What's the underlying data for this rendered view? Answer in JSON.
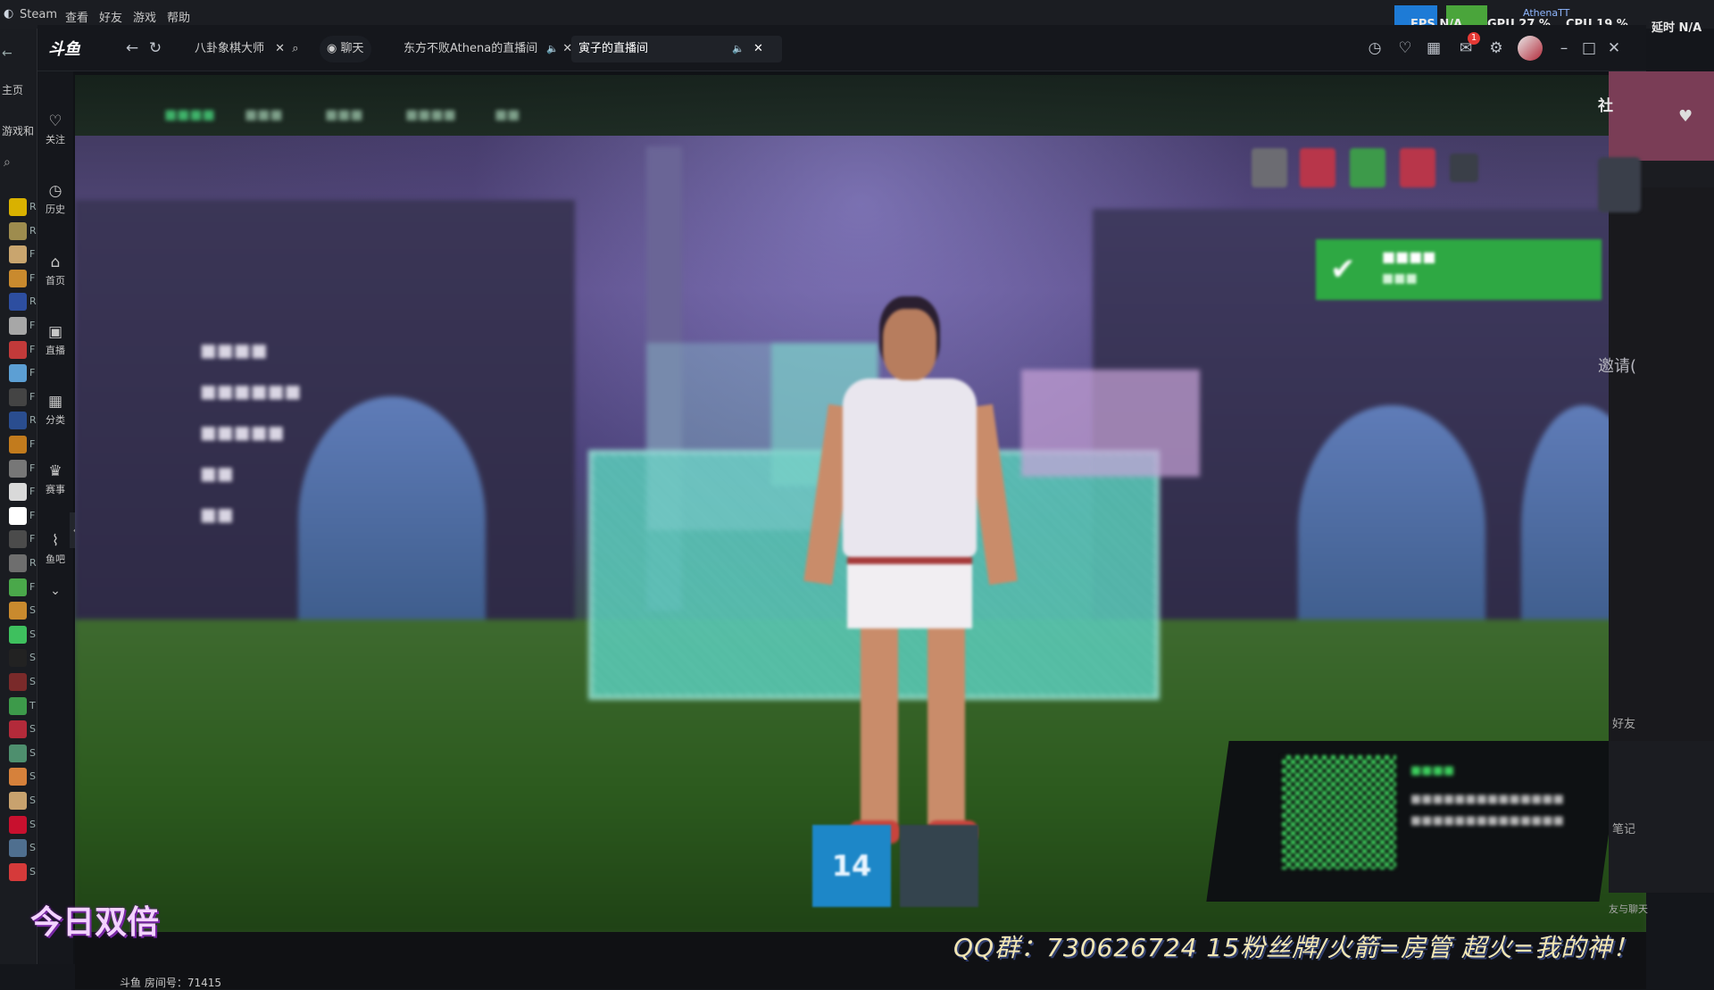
{
  "steam": {
    "app_label": "Steam",
    "menus": [
      "查看",
      "好友",
      "游戏",
      "帮助"
    ],
    "nav": [
      "主页",
      "游戏和"
    ],
    "game_letters": [
      "R",
      "R",
      "F",
      "F",
      "R",
      "F",
      "F",
      "F",
      "F",
      "R",
      "F",
      "F",
      "F",
      "F",
      "F",
      "R",
      "F",
      "S",
      "S",
      "S",
      "S",
      "T",
      "S",
      "S",
      "S",
      "S",
      "S",
      "S",
      "S"
    ]
  },
  "overlay_stats": {
    "fps_label": "FPS",
    "fps_value": "N/A",
    "gpu_label": "GPU",
    "gpu_value": "27 %",
    "cpu_label": "CPU",
    "cpu_value": "19 %",
    "latency_label": "延时",
    "latency_value": "N/A",
    "user_tag": "AthenaTT"
  },
  "douyu": {
    "logo": "斗鱼",
    "tabs": [
      {
        "label": "八卦象棋大师",
        "active": false
      },
      {
        "label": "聊天",
        "active": false
      },
      {
        "label": "东方不败Athena的直播间",
        "active": false
      },
      {
        "label": "寅子的直播间",
        "active": true
      }
    ],
    "notification_count": "1",
    "left_nav": [
      {
        "label": "关注",
        "icon": "heart-icon"
      },
      {
        "label": "历史",
        "icon": "clock-icon"
      },
      {
        "label": "首页",
        "icon": "home-icon"
      },
      {
        "label": "直播",
        "icon": "live-icon"
      },
      {
        "label": "分类",
        "icon": "grid-icon"
      },
      {
        "label": "赛事",
        "icon": "trophy-icon"
      },
      {
        "label": "鱼吧",
        "icon": "fish-icon"
      }
    ],
    "room_label": "斗鱼 房间号：71415"
  },
  "game": {
    "notify_number": "14",
    "right_labels": {
      "invite": "邀请(",
      "friends": "好友",
      "notes": "笔记",
      "chat": "友与聊天",
      "social": "社"
    }
  },
  "stream_overlay": {
    "left_text": "今日双倍",
    "qq_text": "QQ群：730626724  15粉丝牌/火箭=房管  超火=我的神！"
  }
}
